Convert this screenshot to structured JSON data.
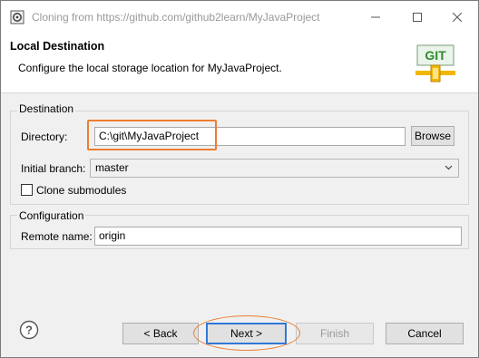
{
  "window": {
    "title": "Cloning from https://github.com/github2learn/MyJavaProject"
  },
  "header": {
    "title": "Local Destination",
    "description": "Configure the local storage location for MyJavaProject.",
    "logo_text": "GIT"
  },
  "destination": {
    "group_title": "Destination",
    "directory_label": "Directory:",
    "directory_value": "C:\\git\\MyJavaProject",
    "browse_label": "Browse",
    "branch_label": "Initial branch:",
    "branch_value": "master",
    "clone_submodules_label": "Clone submodules",
    "clone_submodules_checked": false
  },
  "configuration": {
    "group_title": "Configuration",
    "remote_label": "Remote name:",
    "remote_value": "origin"
  },
  "footer": {
    "back_label": "< Back",
    "next_label": "Next >",
    "finish_label": "Finish",
    "cancel_label": "Cancel"
  },
  "colors": {
    "highlight": "#ed7d31",
    "default_button_border": "#2f79d7",
    "logo_green": "#2e8b2e",
    "logo_bar": "#f2b600"
  },
  "icons": [
    "eclipse-app-icon",
    "minimize-icon",
    "maximize-icon",
    "close-icon",
    "git-logo-icon",
    "chevron-down-icon",
    "help-icon"
  ]
}
